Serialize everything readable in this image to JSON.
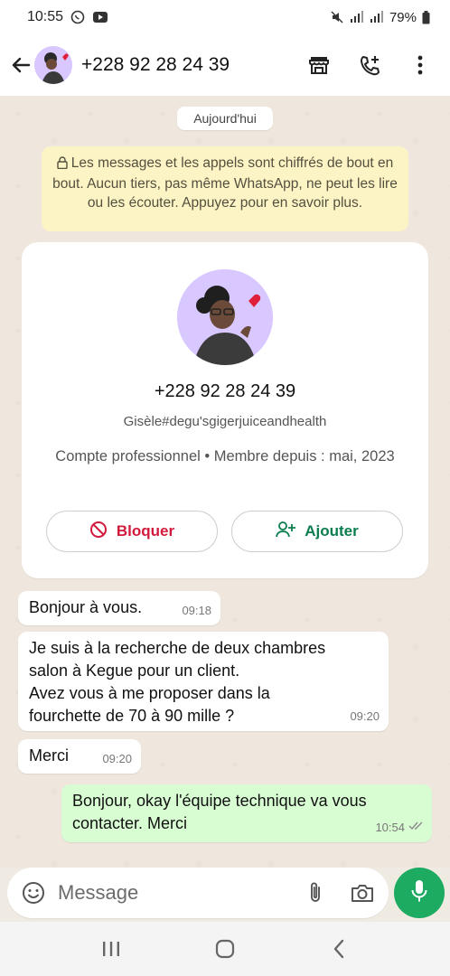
{
  "status_bar": {
    "time": "10:55",
    "battery": "79%"
  },
  "header": {
    "title": "+228 92 28 24 39"
  },
  "chat": {
    "date_chip": "Aujourd'hui",
    "encryption_notice": "Les messages et les appels sont chiffrés de bout en bout. Aucun tiers, pas même WhatsApp, ne peut les lire ou les écouter. Appuyez pour en savoir plus."
  },
  "profile_card": {
    "phone": "+228 92 28 24 39",
    "name": "Gisèle#degu'sgigerjuiceandhealth",
    "meta": "Compte professionnel • Membre depuis : mai, 2023",
    "block_label": "Bloquer",
    "add_label": "Ajouter"
  },
  "messages": [
    {
      "direction": "in",
      "text": "Bonjour à vous.",
      "time": "09:18"
    },
    {
      "direction": "in",
      "lines": [
        "Je suis à la recherche de deux chambres",
        "salon à Kegue pour un client.",
        "Avez vous à me proposer dans la",
        "fourchette de 70 à 90 mille ?"
      ],
      "time": "09:20"
    },
    {
      "direction": "in",
      "text": "Merci",
      "time": "09:20"
    },
    {
      "direction": "out",
      "lines": [
        "Bonjour,  okay l'équipe technique va vous",
        "contacter.  Merci"
      ],
      "time": "10:54",
      "status": "read"
    }
  ],
  "composer": {
    "placeholder": "Message"
  },
  "colors": {
    "outgoing_bubble": "#d9fdd3",
    "mic_button": "#1daa61",
    "block_red": "#d11a3c",
    "add_green": "#0a7d4e",
    "notice_bg": "#fdf4c5"
  },
  "icons": [
    "back-arrow-icon",
    "shop-icon",
    "add-call-icon",
    "more-vert-icon",
    "lock-icon",
    "block-icon",
    "add-person-icon",
    "emoji-icon",
    "attach-icon",
    "camera-icon",
    "mic-icon",
    "double-check-icon"
  ]
}
